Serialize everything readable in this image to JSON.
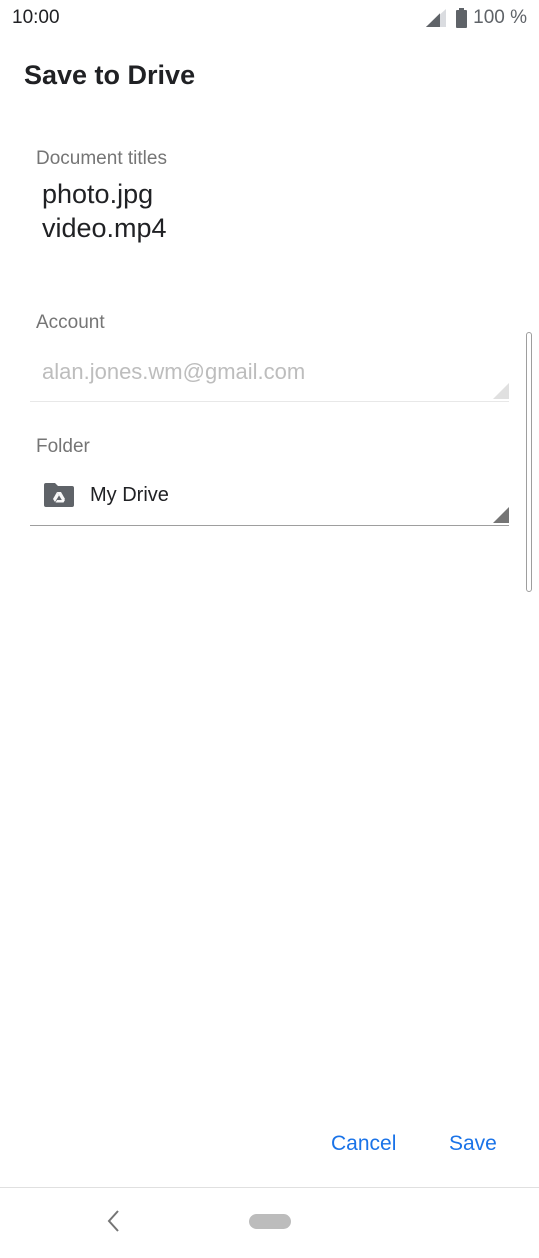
{
  "status_bar": {
    "time": "10:00",
    "battery_text": "100 %",
    "icons": [
      "signal-icon",
      "battery-icon"
    ]
  },
  "title": "Save to Drive",
  "document": {
    "label": "Document titles",
    "names": [
      "photo.jpg",
      "video.mp4"
    ]
  },
  "account": {
    "label": "Account",
    "value": "alan.jones.wm@gmail.com"
  },
  "folder": {
    "label": "Folder",
    "value": "My Drive",
    "icon": "drive-folder-icon"
  },
  "actions": {
    "cancel_label": "Cancel",
    "save_label": "Save"
  },
  "colors": {
    "accent": "#1a73e8",
    "label": "#757575",
    "disabled_text": "#bdbdbd",
    "text": "#202124"
  }
}
